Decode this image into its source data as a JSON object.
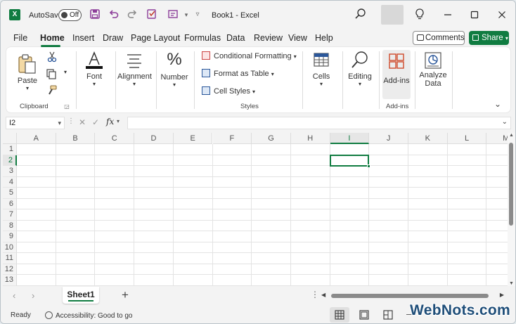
{
  "titlebar": {
    "autosave_label": "AutoSave",
    "autosave_state": "Off",
    "doc_title": "Book1  -  Excel"
  },
  "menu": {
    "items": [
      "File",
      "Home",
      "Insert",
      "Draw",
      "Page Layout",
      "Formulas",
      "Data",
      "Review",
      "View",
      "Help"
    ],
    "active": "Home",
    "comments_label": "Comments",
    "share_label": "Share"
  },
  "ribbon": {
    "paste_label": "Paste",
    "clipboard_label": "Clipboard",
    "font_label": "Font",
    "alignment_label": "Alignment",
    "number_label": "Number",
    "conditional_formatting": "Conditional Formatting",
    "format_as_table": "Format as Table",
    "cell_styles": "Cell Styles",
    "styles_label": "Styles",
    "cells_label": "Cells",
    "editing_label": "Editing",
    "addins_label": "Add-ins",
    "addins_group_label": "Add-ins",
    "analyze_label_1": "Analyze",
    "analyze_label_2": "Data"
  },
  "formula_bar": {
    "name_box": "I2",
    "fx": "fx",
    "value": ""
  },
  "sheet": {
    "columns": [
      "A",
      "B",
      "C",
      "D",
      "E",
      "F",
      "G",
      "H",
      "I",
      "J",
      "K",
      "L",
      "M"
    ],
    "rows": [
      "1",
      "2",
      "3",
      "4",
      "5",
      "6",
      "7",
      "8",
      "9",
      "10",
      "11",
      "12",
      "13"
    ],
    "active_cell": "I2"
  },
  "tabs": {
    "sheet_name": "Sheet1"
  },
  "status": {
    "ready": "Ready",
    "accessibility": "Accessibility: Good to go"
  },
  "watermark": "WebNots.com",
  "colors": {
    "accent": "#107c41",
    "quick_access": "#8c3d99"
  }
}
